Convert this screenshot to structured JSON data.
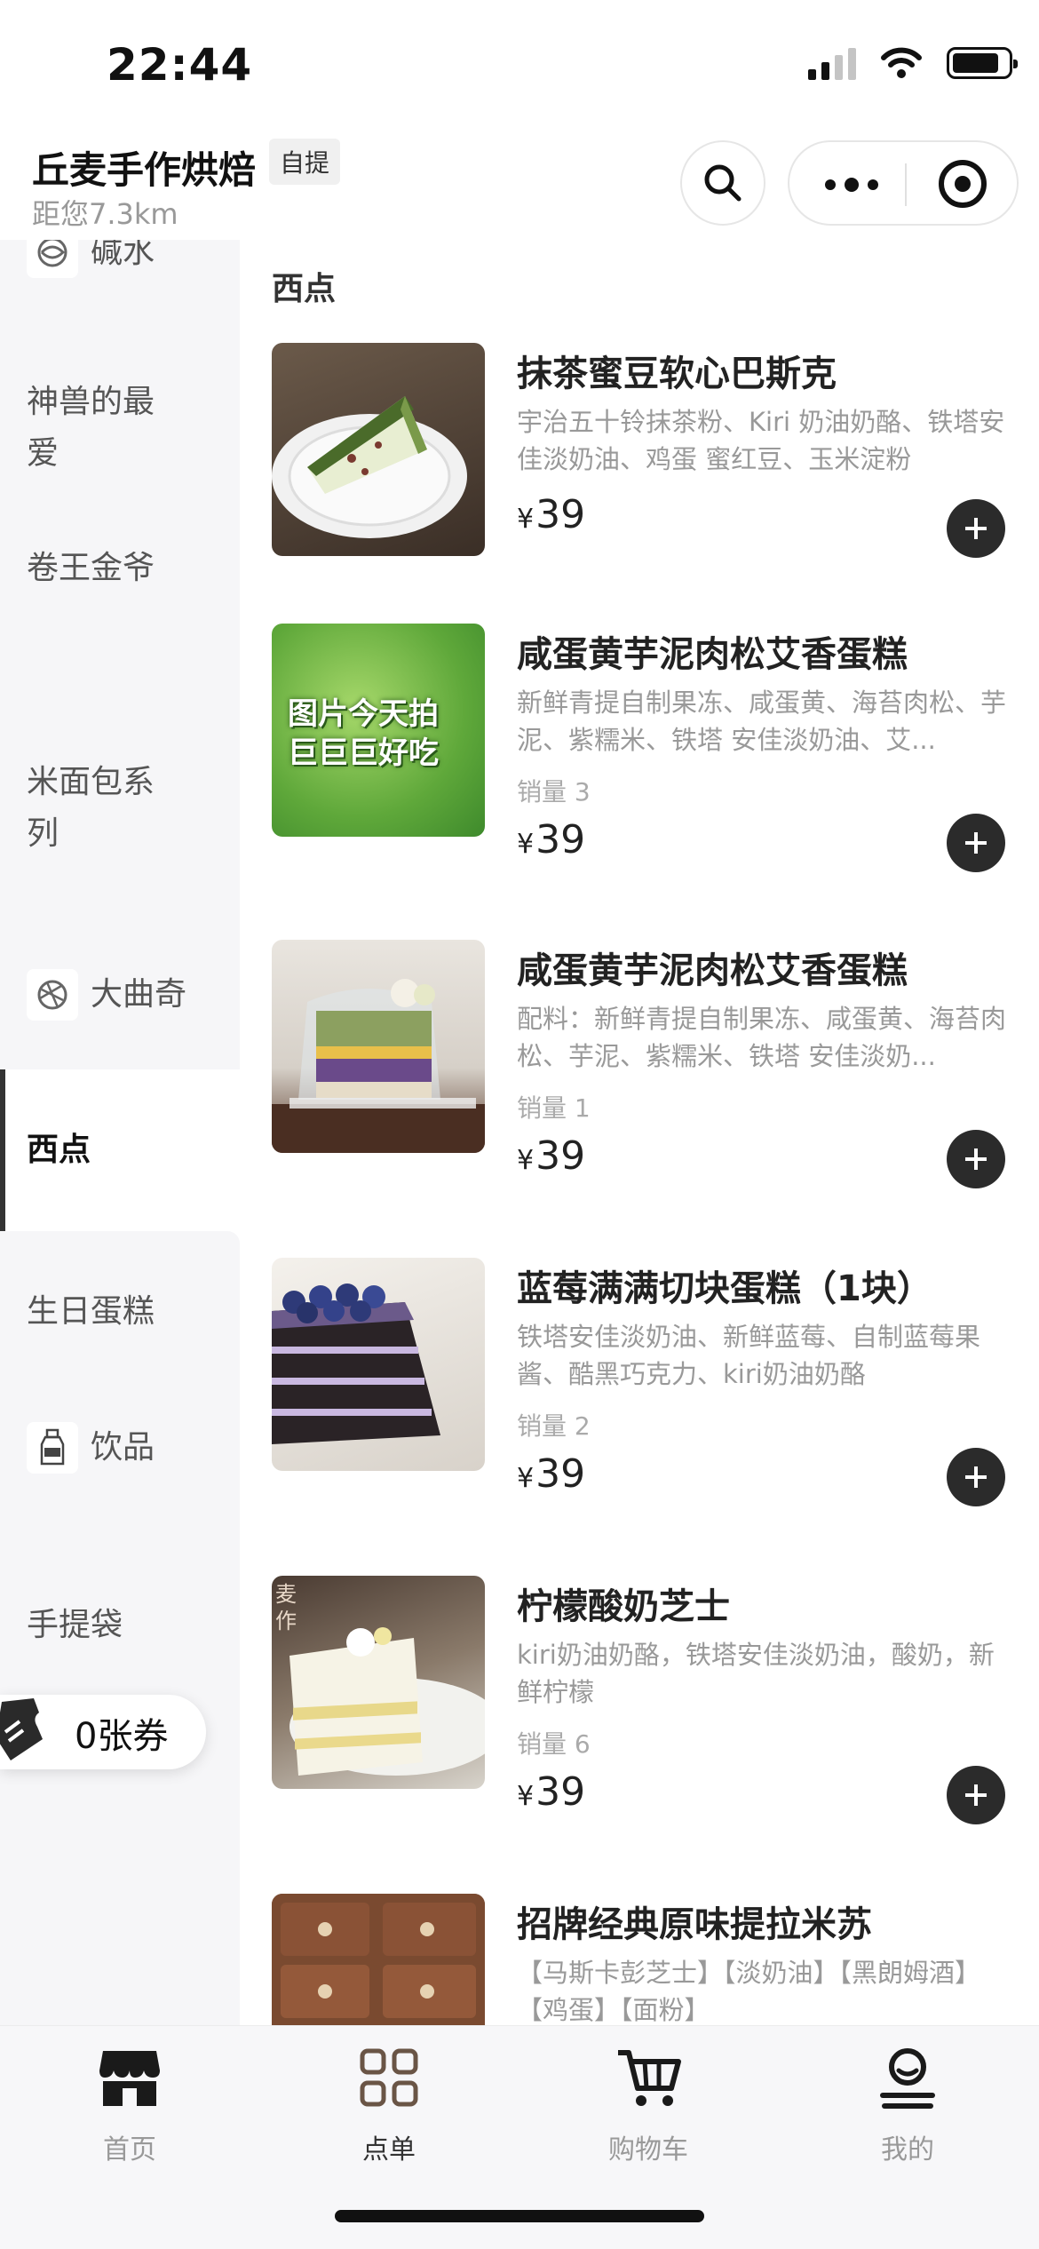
{
  "status_bar": {
    "time": "22:44",
    "battery_level": 0.85,
    "signal_bars": 2
  },
  "header": {
    "store_name": "丘麦手作烘焙",
    "mode_badge": "自提",
    "distance": "距您7.3km",
    "search_icon": "search-icon",
    "more_icon": "more-icon",
    "close_icon": "target-icon"
  },
  "sidebar": {
    "items": [
      {
        "label": "碱水",
        "icon": "pretzel-icon"
      },
      {
        "label": "神兽的最爱"
      },
      {
        "label": "卷王金爷"
      },
      {
        "label": "米面包系列"
      },
      {
        "label": "大曲奇",
        "icon": "cookie-icon"
      },
      {
        "label": "西点",
        "active": true
      },
      {
        "label": "生日蛋糕"
      },
      {
        "label": "饮品",
        "icon": "bottle-icon"
      },
      {
        "label": "手提袋"
      }
    ],
    "coupon": "0张券"
  },
  "main": {
    "section_title": "西点",
    "products": [
      {
        "name": "抹茶蜜豆软心巴斯克",
        "desc": "宇治五十铃抹茶粉、Kiri 奶油奶酪、铁塔安佳淡奶油、鸡蛋 蜜红豆、玉米淀粉",
        "sales": "",
        "currency": "¥",
        "price": "39"
      },
      {
        "name": "咸蛋黄芋泥肉松艾香蛋糕",
        "desc": "新鲜青提自制果冻、咸蛋黄、海苔肉松、芋泥、紫糯米、铁塔 安佳淡奶油、艾...",
        "sales": "销量 3",
        "currency": "¥",
        "price": "39",
        "image_caption_1": "图片今天拍",
        "image_caption_2": "巨巨巨好吃"
      },
      {
        "name": "咸蛋黄芋泥肉松艾香蛋糕",
        "desc": "配料：新鲜青提自制果冻、咸蛋黄、海苔肉松、芋泥、紫糯米、铁塔 安佳淡奶...",
        "sales": "销量 1",
        "currency": "¥",
        "price": "39"
      },
      {
        "name": "蓝莓满满切块蛋糕（1块）",
        "desc": "铁塔安佳淡奶油、新鲜蓝莓、自制蓝莓果酱、酷黑巧克力、kiri奶油奶酪",
        "sales": "销量 2",
        "currency": "¥",
        "price": "39"
      },
      {
        "name": "柠檬酸奶芝士",
        "desc": "kiri奶油奶酪，铁塔安佳淡奶油，酸奶，新鲜柠檬",
        "sales": "销量 6",
        "currency": "¥",
        "price": "39",
        "image_watermark": "麦作"
      },
      {
        "name": "招牌经典原味提拉米苏",
        "desc": "【马斯卡彭芝士】【淡奶油】【黑朗姆酒】【鸡蛋】【面粉】",
        "sales": "",
        "currency": "¥",
        "price": ""
      }
    ]
  },
  "tabbar": {
    "tabs": [
      {
        "label": "首页",
        "icon": "store-icon"
      },
      {
        "label": "点单",
        "icon": "grid-icon",
        "active": true
      },
      {
        "label": "购物车",
        "icon": "cart-icon"
      },
      {
        "label": "我的",
        "icon": "user-icon"
      }
    ]
  }
}
